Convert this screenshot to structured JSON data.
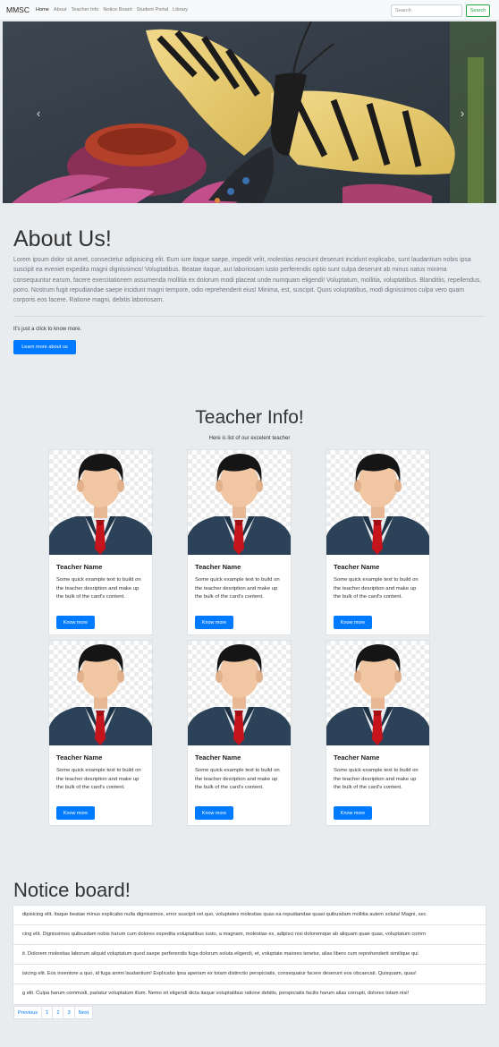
{
  "navbar": {
    "brand": "MMSC",
    "links": [
      "Home",
      "About",
      "Teacher Info",
      "Notice Board",
      "Student Portal",
      "Library"
    ],
    "active": "Home",
    "search_placeholder": "Search",
    "search_button": "Search"
  },
  "carousel": {
    "prev_icon": "‹",
    "next_icon": "›",
    "slide_count": 3,
    "active_slide": 2
  },
  "about": {
    "title": "About Us!",
    "text": "Lorem ipsum dolor sit amet, consectetur adipisicing elit. Eum iure itaque saepe, impedit velit, molestias nesciunt deserunt incidunt explicabo, sunt laudantium nobis ipsa suscipit ea eveniet expedita magni dignissimos! Voluptatibus. Beatae itaque, aut laboriosam iusto perferendis optio sunt culpa deserunt ab minus natus minima consequuntur earum, facere exercitationem assumenda mollitia ex dolorum modi placeat unde numquam eligendi! Voluptatum, mollitia, voluptatibus. Blanditiis, repellendus, porro. Nostrum fugit repudiandae saepe incidunt magni tempore, odio reprehenderit eius! Minima, est, suscipit. Quos voluptatibus, modi dignissimos culpa vero quam corporis eos facere. Ratione magni, debitis laboriosam.",
    "click_text": "It's just a click to know more.",
    "button": "Learn more about us"
  },
  "teachers": {
    "title": "Teacher Info!",
    "subtitle": "Here is list of our excelent teacher",
    "cards": [
      {
        "name": "Teacher Name",
        "text": "Some quick example text to build on the teacher desription and make up the bulk of the card's content.",
        "button": "Know more"
      },
      {
        "name": "Teacher Name",
        "text": "Some quick example text to build on the teacher desription and make up the bulk of the card's content.",
        "button": "Know more"
      },
      {
        "name": "Teacher Name",
        "text": "Some quick example text to build on the teacher desription and make up the bulk of the card's content.",
        "button": "Know more"
      },
      {
        "name": "Teacher Name",
        "text": "Some quick example text to build on the teacher desription and make up the bulk of the card's content.",
        "button": "Know more"
      },
      {
        "name": "Teacher Name",
        "text": "Some quick example text to build on the teacher desription and make up the bulk of the card's content.",
        "button": "Know more"
      },
      {
        "name": "Teacher Name",
        "text": "Some quick example text to build on the teacher desription and make up the bulk of the card's content.",
        "button": "Know more"
      }
    ]
  },
  "notice": {
    "title": "Notice board!",
    "items": [
      "dipisicing elit. Itaque beatae minus explicabo nulla dignissimos, error suscipit vel quo, voluptates molestias quas ea repudiandae quasi quibusdam mollitia autem soluta! Magni, sec",
      "cing elit. Dignissimos quibusdam nobis harum cum dolores expedita voluptatibus iusto, a magnam, molestias ex, adipisci nisi doloremque ab aliquam quae quas, voluptatum comm",
      "it. Dolorem molestias laborum aliquid voluptatum quod saepe perferendis fuga dolorum soluta eligendi, et, voluptate maiores tenetur, alias libero cum reprehenderit similique qui",
      "isicing elit. Eos inventore a quo, id fuga animi laudantium! Explicabo ipsa aperiam ex totam distinctio perspiciatis, consequatur facere deserunt eos obcaecati. Quisquam, quas!",
      "g elit. Culpa harum commodi, pariatur voluptatum illum. Nemo sit eligendi dicta itaque voluptatibus ratione debitis, perspiciatis facilis harum alias corrupti, dolores totam nisi!"
    ]
  },
  "pagination": [
    "Previous",
    "1",
    "2",
    "3",
    "Next"
  ],
  "colors": {
    "primary": "#007bff",
    "success": "#28a745",
    "page_bg": "#e9ecef",
    "navbar_bg": "#f8f9fa"
  }
}
